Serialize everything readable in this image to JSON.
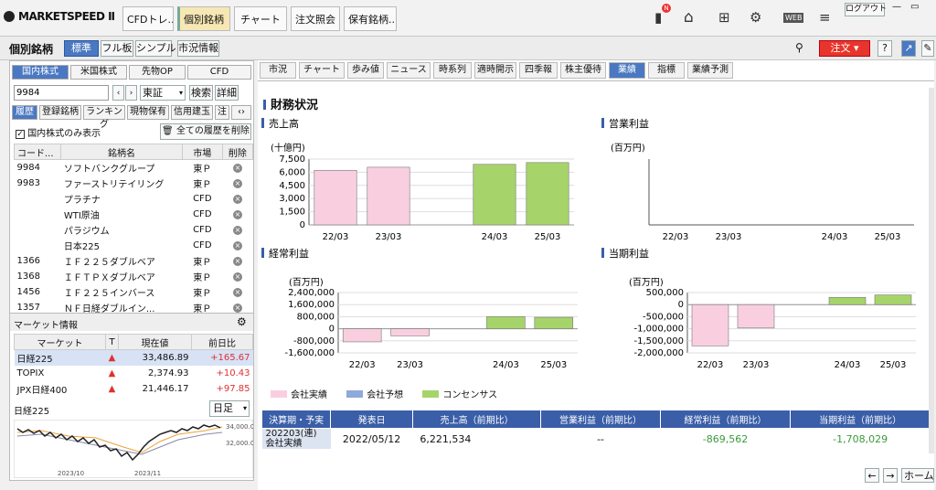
{
  "app": {
    "logo": "MARKETSPEED Ⅱ",
    "logout": "ログアウト"
  },
  "top_tabs": [
    "CFDトレ...",
    "個別銘柄",
    "チャート",
    "注文照会",
    "保有銘柄..."
  ],
  "toolbar2": {
    "title": "個別銘柄",
    "views": [
      "標準",
      "フル板",
      "シンプル"
    ],
    "market_info": "市況情報",
    "order": "注文"
  },
  "left": {
    "market_tabs": [
      "国内株式",
      "米国株式",
      "先物OP",
      "CFD"
    ],
    "code": "9984",
    "exchange": "東証",
    "search": "検索",
    "detail": "詳細",
    "sub_tabs": [
      "履歴",
      "登録銘柄",
      "ランキング",
      "現物保有",
      "信用建玉",
      "注"
    ],
    "only_domestic": "国内株式のみ表示",
    "delete_all": "全ての履歴を削除",
    "history_headers": [
      "コード...",
      "銘柄名",
      "市場",
      "削除"
    ],
    "history": [
      {
        "code": "9984",
        "name": "ソフトバンクグループ",
        "market": "東Ｐ"
      },
      {
        "code": "9983",
        "name": "ファーストリテイリング",
        "market": "東Ｐ"
      },
      {
        "code": "",
        "name": "プラチナ",
        "market": "CFD"
      },
      {
        "code": "",
        "name": "WTI原油",
        "market": "CFD"
      },
      {
        "code": "",
        "name": "パラジウム",
        "market": "CFD"
      },
      {
        "code": "",
        "name": "日本225",
        "market": "CFD"
      },
      {
        "code": "1366",
        "name": "ＩＦ２２５ダブルベア",
        "market": "東Ｐ"
      },
      {
        "code": "1368",
        "name": "ＩＦＴＰＸダブルベア",
        "market": "東Ｐ"
      },
      {
        "code": "1456",
        "name": "ＩＦ２２５インバース",
        "market": "東Ｐ"
      },
      {
        "code": "1357",
        "name": "ＮＦ日経ダブルイン...",
        "market": "東Ｐ"
      }
    ],
    "market_info_title": "マーケット情報",
    "market_headers": [
      "マーケット",
      "T",
      "現在値",
      "前日比"
    ],
    "markets": [
      {
        "name": "日経225",
        "price": "33,486.89",
        "change": "+165.67"
      },
      {
        "name": "TOPIX",
        "price": "2,374.93",
        "change": "+10.43"
      },
      {
        "name": "JPX日経400",
        "price": "21,446.17",
        "change": "+97.85"
      }
    ],
    "mini_chart": {
      "title": "日経225",
      "period": "日足",
      "y_labels": [
        "34,000.0",
        "32,000.0"
      ],
      "x_labels": [
        "2023/10",
        "2023/11"
      ]
    }
  },
  "main": {
    "tabs": [
      "市況",
      "チャート",
      "歩み値",
      "ニュース",
      "時系列",
      "適時開示",
      "四季報",
      "株主優待",
      "業績",
      "指標",
      "業績予測"
    ],
    "section_title": "財務状況",
    "legend": [
      "会社実績",
      "会社予想",
      "コンセンサス"
    ],
    "summary_headers": [
      "決算期・予実",
      "発表日",
      "売上高（前期比）",
      "営業利益（前期比）",
      "経常利益（前期比）",
      "当期利益（前期比）"
    ],
    "summary_row": [
      "202203(連)",
      "2022/05/12",
      "6,221,534",
      "--",
      "-869,562",
      "-1,708,029"
    ],
    "summary_row_sub": "会社実績",
    "nav": [
      "←",
      "→",
      "ホーム"
    ]
  },
  "chart_data": [
    {
      "type": "bar",
      "title": "売上高",
      "unit": "(十億円)",
      "categories": [
        "22/03",
        "23/03",
        "",
        "24/03",
        "25/03"
      ],
      "values": [
        6221.5,
        6570,
        null,
        6900,
        7100
      ],
      "kinds": [
        "actual",
        "actual",
        null,
        "consensus",
        "consensus"
      ],
      "ylim": [
        0,
        7500
      ],
      "ticks": [
        "7,500",
        "6,000",
        "4,500",
        "3,000",
        "1,500",
        "0"
      ]
    },
    {
      "type": "bar",
      "title": "営業利益",
      "unit": "(百万円)",
      "categories": [
        "22/03",
        "23/03",
        "",
        "24/03",
        "25/03"
      ],
      "values": [
        null,
        null,
        null,
        null,
        null
      ],
      "ticks": []
    },
    {
      "type": "bar",
      "title": "経常利益",
      "unit": "(百万円)",
      "categories": [
        "22/03",
        "23/03",
        "",
        "24/03",
        "25/03"
      ],
      "values": [
        -869562,
        -469000,
        null,
        800000,
        760000
      ],
      "kinds": [
        "actual",
        "actual",
        null,
        "consensus",
        "consensus"
      ],
      "ylim": [
        -1600000,
        2400000
      ],
      "ticks": [
        "2,400,000",
        "1,600,000",
        "800,000",
        "0",
        "-800,000",
        "-1,600,000"
      ]
    },
    {
      "type": "bar",
      "title": "当期利益",
      "unit": "(百万円)",
      "categories": [
        "22/03",
        "23/03",
        "",
        "24/03",
        "25/03"
      ],
      "values": [
        -1708029,
        -970000,
        null,
        300000,
        400000
      ],
      "kinds": [
        "actual",
        "actual",
        null,
        "consensus",
        "consensus"
      ],
      "ylim": [
        -2000000,
        500000
      ],
      "ticks": [
        "500,000",
        "0",
        "-500,000",
        "-1,000,000",
        "-1,500,000",
        "-2,000,000"
      ]
    }
  ],
  "colors": {
    "actual": "#f9cfe0",
    "forecast": "#8fa9d8",
    "consensus": "#a6d46a",
    "accent": "#4a78c2",
    "header": "#3a5ea8",
    "order": "#e8352c"
  }
}
